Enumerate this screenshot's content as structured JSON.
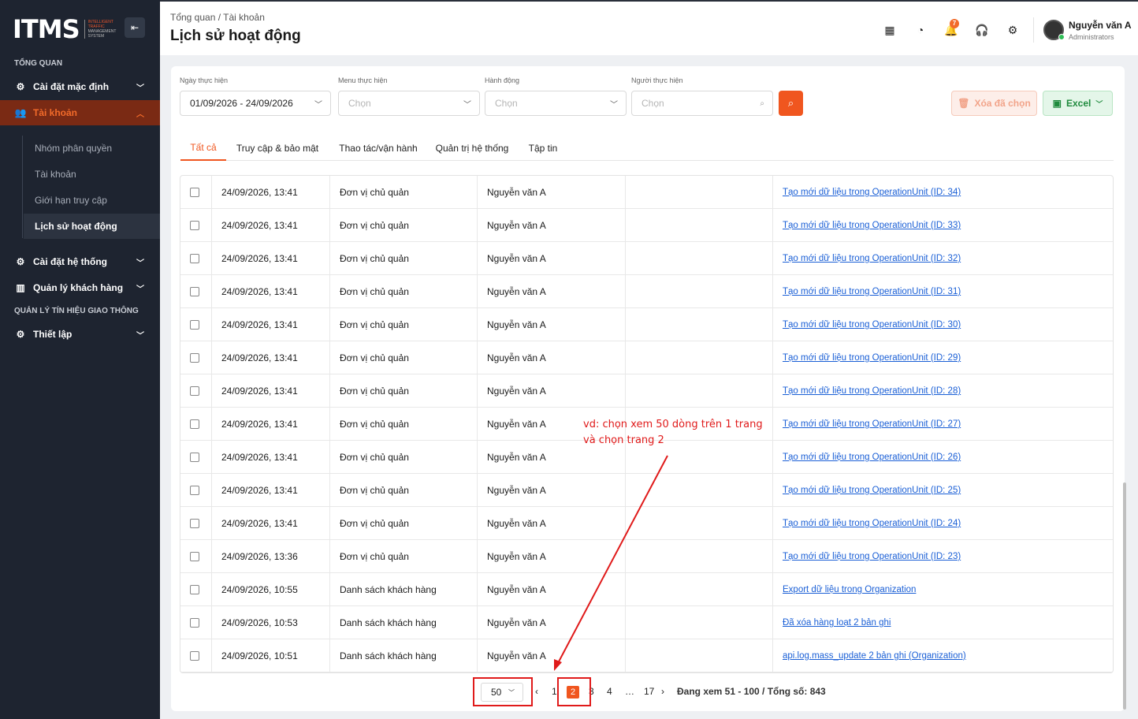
{
  "sidebar": {
    "logo": {
      "main": "ITMS",
      "sub": [
        "INTELLIGENT",
        "TRAFFIC",
        "MANAGEMENT",
        "SYSTEM"
      ]
    },
    "section_overview": "TỔNG QUAN",
    "items": [
      {
        "label": "Cài đặt mặc định",
        "icon": "gear-icon"
      },
      {
        "label": "Tài khoản",
        "icon": "users-icon"
      },
      {
        "label": "Cài đặt hệ thống",
        "icon": "settings-icon"
      },
      {
        "label": "Quản lý khách hàng",
        "icon": "building-icon"
      },
      {
        "label": "Thiết lập",
        "icon": "gear-icon"
      }
    ],
    "subitems": [
      "Nhóm phân quyền",
      "Tài khoản",
      "Giới hạn truy cập",
      "Lịch sử hoạt động"
    ],
    "section_traffic": "QUẢN LÝ TÍN HIỆU GIAO THÔNG"
  },
  "header": {
    "breadcrumb": "Tổng quan  /  Tài khoản",
    "title": "Lịch sử hoạt động",
    "notification_count": "7",
    "user_name": "Nguyễn văn A",
    "user_role": "Administrators"
  },
  "filters": {
    "date_label": "Ngày thực hiện",
    "date_value": "01/09/2026 - 24/09/2026",
    "menu_label": "Menu thực hiện",
    "menu_placeholder": "Chọn",
    "action_label": "Hành động",
    "action_placeholder": "Chọn",
    "user_label": "Người thực hiện",
    "user_placeholder": "Chọn",
    "delete_label": "Xóa đã chọn",
    "excel_label": "Excel"
  },
  "tabs": [
    "Tất cả",
    "Truy cập & bảo mật",
    "Thao tác/vận hành",
    "Quản trị hệ thống",
    "Tập tin"
  ],
  "rows": [
    {
      "time": "24/09/2026, 13:41",
      "menu": "Đơn vị chủ quản",
      "user": "Nguyễn văn A",
      "detail": "Tạo mới dữ liệu trong OperationUnit (ID: 34)"
    },
    {
      "time": "24/09/2026, 13:41",
      "menu": "Đơn vị chủ quản",
      "user": "Nguyễn văn A",
      "detail": "Tạo mới dữ liệu trong OperationUnit (ID: 33)"
    },
    {
      "time": "24/09/2026, 13:41",
      "menu": "Đơn vị chủ quản",
      "user": "Nguyễn văn A",
      "detail": "Tạo mới dữ liệu trong OperationUnit (ID: 32)"
    },
    {
      "time": "24/09/2026, 13:41",
      "menu": "Đơn vị chủ quản",
      "user": "Nguyễn văn A",
      "detail": "Tạo mới dữ liệu trong OperationUnit (ID: 31)"
    },
    {
      "time": "24/09/2026, 13:41",
      "menu": "Đơn vị chủ quản",
      "user": "Nguyễn văn A",
      "detail": "Tạo mới dữ liệu trong OperationUnit (ID: 30)"
    },
    {
      "time": "24/09/2026, 13:41",
      "menu": "Đơn vị chủ quản",
      "user": "Nguyễn văn A",
      "detail": "Tạo mới dữ liệu trong OperationUnit (ID: 29)"
    },
    {
      "time": "24/09/2026, 13:41",
      "menu": "Đơn vị chủ quản",
      "user": "Nguyễn văn A",
      "detail": "Tạo mới dữ liệu trong OperationUnit (ID: 28)"
    },
    {
      "time": "24/09/2026, 13:41",
      "menu": "Đơn vị chủ quản",
      "user": "Nguyễn văn A",
      "detail": "Tạo mới dữ liệu trong OperationUnit (ID: 27)"
    },
    {
      "time": "24/09/2026, 13:41",
      "menu": "Đơn vị chủ quản",
      "user": "Nguyễn văn A",
      "detail": "Tạo mới dữ liệu trong OperationUnit (ID: 26)"
    },
    {
      "time": "24/09/2026, 13:41",
      "menu": "Đơn vị chủ quản",
      "user": "Nguyễn văn A",
      "detail": "Tạo mới dữ liệu trong OperationUnit (ID: 25)"
    },
    {
      "time": "24/09/2026, 13:41",
      "menu": "Đơn vị chủ quản",
      "user": "Nguyễn văn A",
      "detail": "Tạo mới dữ liệu trong OperationUnit (ID: 24)"
    },
    {
      "time": "24/09/2026, 13:36",
      "menu": "Đơn vị chủ quản",
      "user": "Nguyễn văn A",
      "detail": "Tạo mới dữ liệu trong OperationUnit (ID: 23)"
    },
    {
      "time": "24/09/2026, 10:55",
      "menu": "Danh sách khách hàng",
      "user": "Nguyễn văn A",
      "detail": "Export dữ liệu trong Organization"
    },
    {
      "time": "24/09/2026, 10:53",
      "menu": "Danh sách khách hàng",
      "user": "Nguyễn văn A",
      "detail": "Đã xóa hàng loạt 2 bản ghi"
    },
    {
      "time": "24/09/2026, 10:51",
      "menu": "Danh sách khách hàng",
      "user": "Nguyễn văn A",
      "detail": "api.log.mass_update 2 bản ghi (Organization)"
    }
  ],
  "pagination": {
    "page_size": "50",
    "prev": "‹",
    "pages": [
      "1",
      "2",
      "3",
      "4",
      "…",
      "17"
    ],
    "current": "2",
    "next": "›",
    "info": "Đang xem 51 - 100 / Tổng số: 843"
  },
  "annotation": {
    "line1": "vd: chọn xem 50 dòng trên 1 trang",
    "line2": "và chọn trang 2",
    "color": "#e01a1a"
  },
  "colors": {
    "accent": "#f0561f",
    "sidebar_bg": "#1e2430",
    "link": "#1a5fd6"
  }
}
